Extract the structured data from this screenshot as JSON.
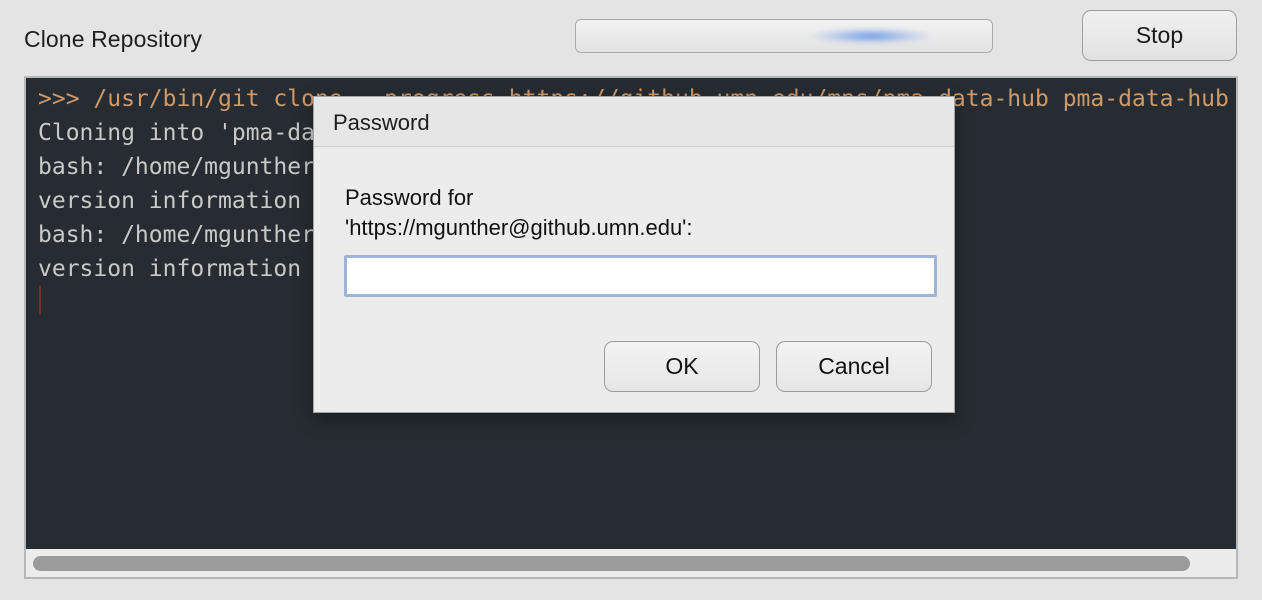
{
  "window": {
    "title": "Clone Repository",
    "stop_label": "Stop",
    "progress_indeterminate": true
  },
  "terminal": {
    "lines": [
      ">>> /usr/bin/git clone --progress https://github.umn.edu/mps/pma-data-hub pma-data-hub",
      "Cloning into 'pma-data-hub'...",
      "bash: /home/mgunther/anaconda3/lib/libtinfo.so.6: no",
      "version information available (required by bash)",
      "bash: /home/mgunther/anaconda3/lib/libtinfo.so.6: no",
      "version information available (required by bash)"
    ],
    "colors": {
      "background": "#262c31",
      "text": "#c9c9c9",
      "command": "#cf9a6b"
    }
  },
  "dialog": {
    "title": "Password",
    "message_line1": "Password for",
    "message_line2": "'https://mgunther@github.umn.edu':",
    "input_value": "",
    "ok_label": "OK",
    "cancel_label": "Cancel"
  }
}
